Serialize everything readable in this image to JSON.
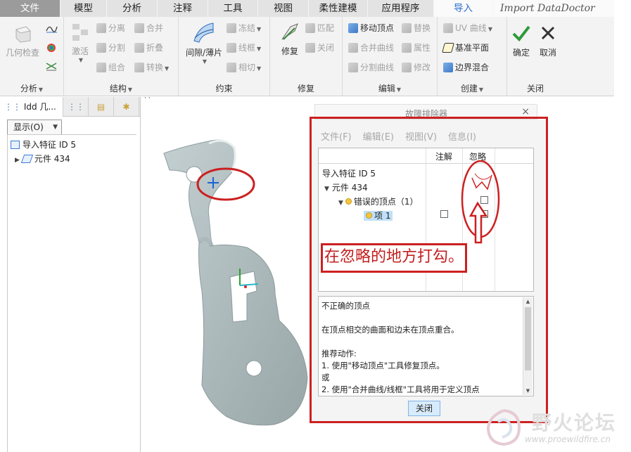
{
  "tabs": [
    {
      "label": "文件",
      "w": 86
    },
    {
      "label": "模型",
      "w": 66
    },
    {
      "label": "分析",
      "w": 72
    },
    {
      "label": "注释",
      "w": 72
    },
    {
      "label": "工具",
      "w": 71
    },
    {
      "label": "视图",
      "w": 72
    },
    {
      "label": "柔性建模",
      "w": 84
    },
    {
      "label": "应用程序",
      "w": 94
    },
    {
      "label": "导入",
      "w": 84
    },
    {
      "label": "Import DataDoctor",
      "w": 172
    }
  ],
  "ribbon": {
    "analysis": {
      "label": "分析",
      "geometry_check": "几何检查"
    },
    "structure": {
      "label": "结构",
      "activate": "激活",
      "split_s": "分离",
      "merge": "合并",
      "split": "分割",
      "fold": "折叠",
      "group": "组合",
      "convert": "转换"
    },
    "constraint": {
      "label": "约束",
      "gap": "间隙/薄片",
      "freeze": "冻结",
      "wireframe": "线框",
      "tangent": "相切"
    },
    "repair": {
      "label": "修复",
      "repair": "修复",
      "match": "匹配",
      "close": "关闭"
    },
    "edit": {
      "label": "编辑",
      "move_vertex": "移动顶点",
      "replace": "替换",
      "merge_curve": "合并曲线",
      "property": "属性",
      "split_curve": "分割曲线",
      "modify": "修改"
    },
    "create": {
      "label": "创建",
      "uv_curve": "UV 曲线",
      "datum_plane": "基准平面",
      "boundary_blend": "边界混合"
    },
    "closegrp": {
      "label": "关闭",
      "ok": "确定",
      "cancel": "取消"
    }
  },
  "left_panel": {
    "tab_label": "Idd 几...",
    "show_label": "显示(O)",
    "tree": [
      "导入特征 ID 5",
      "元件 434"
    ]
  },
  "dialog": {
    "title": "故障排除器",
    "menus": [
      "文件(F)",
      "编辑(E)",
      "视图(V)",
      "信息(I)"
    ],
    "col_note": "注解",
    "col_ignore": "忽略",
    "rows": [
      "导入特征 ID 5",
      "元件 434",
      "错误的顶点（1）",
      "项 1"
    ],
    "annotation": "在忽略的地方打勾。",
    "description": [
      "不正确的顶点",
      "",
      "在顶点相交的曲面和边未在顶点重合。",
      "",
      "推荐动作:",
      "1. 使用\"移动顶点\"工具修复顶点。",
      "或",
      "2. 使用\"合并曲线/线框\"工具将用于定义顶点"
    ],
    "close_button": "关闭"
  },
  "watermark": {
    "title": "野火论坛",
    "url": "www.proewildfire.cn"
  },
  "colors": {
    "annotation_red": "#cc2020",
    "accent_blue": "#2a6fd0",
    "part_fill": "#a9b6b8"
  }
}
